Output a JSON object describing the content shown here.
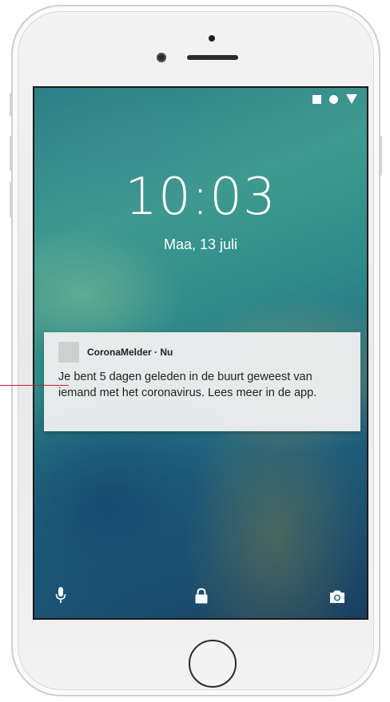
{
  "status_bar": {
    "icons": [
      "square-icon",
      "circle-icon",
      "triangle-icon"
    ]
  },
  "lockscreen": {
    "time": "10:03",
    "date": "Maa, 13 juli"
  },
  "notification": {
    "app_name": "CoronaMelder · Nu",
    "message": "Je bent 5 dagen geleden in de buurt geweest van iemand met het coronavirus. Lees meer in de app."
  },
  "bottom_bar": {
    "icons": [
      "microphone-icon",
      "lock-icon",
      "camera-icon"
    ]
  },
  "colors": {
    "annotation_line": "#b8232f",
    "notification_bg": "#eeeeee",
    "text": "#222222"
  }
}
